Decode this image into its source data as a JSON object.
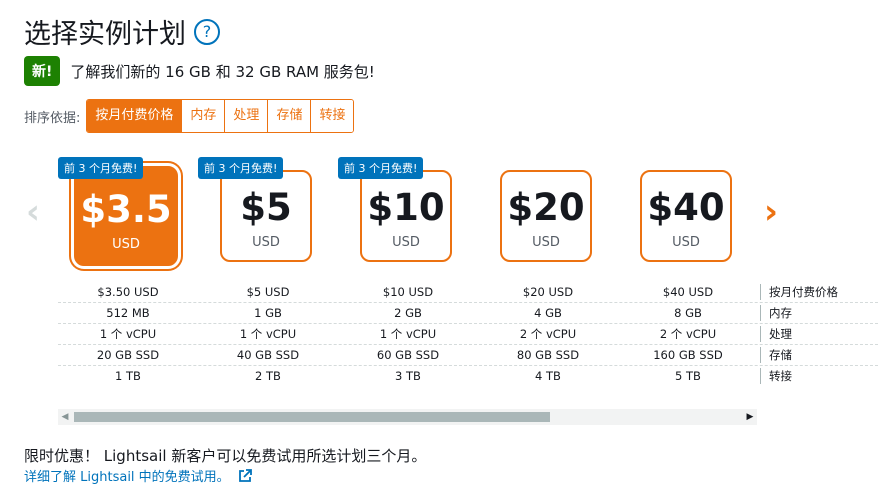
{
  "header": {
    "title": "选择实例计划",
    "help_icon": "?"
  },
  "promo": {
    "badge": "新!",
    "text": "了解我们新的 16 GB 和 32 GB RAM 服务包!"
  },
  "sort": {
    "label": "排序依据:",
    "options": [
      "按月付费价格",
      "内存",
      "处理",
      "存储",
      "转接"
    ],
    "selected": "按月付费价格"
  },
  "accent_color": "#ec7211",
  "link_color": "#0073bb",
  "badge_color": "#1d8102",
  "plans": [
    {
      "price": "$3.5",
      "unit": "USD",
      "free_badge": "前 3 个月免费!",
      "selected": true,
      "monthly": "$3.50 USD",
      "memory": "512 MB",
      "cpu": "1 个 vCPU",
      "storage": "20 GB SSD",
      "transfer": "1 TB"
    },
    {
      "price": "$5",
      "unit": "USD",
      "free_badge": "前 3 个月免费!",
      "selected": false,
      "monthly": "$5 USD",
      "memory": "1 GB",
      "cpu": "1 个 vCPU",
      "storage": "40 GB SSD",
      "transfer": "2 TB"
    },
    {
      "price": "$10",
      "unit": "USD",
      "free_badge": "前 3 个月免费!",
      "selected": false,
      "monthly": "$10 USD",
      "memory": "2 GB",
      "cpu": "1 个 vCPU",
      "storage": "60 GB SSD",
      "transfer": "3 TB"
    },
    {
      "price": "$20",
      "unit": "USD",
      "free_badge": "",
      "selected": false,
      "monthly": "$20 USD",
      "memory": "4 GB",
      "cpu": "2 个 vCPU",
      "storage": "80 GB SSD",
      "transfer": "4 TB"
    },
    {
      "price": "$40",
      "unit": "USD",
      "free_badge": "",
      "selected": false,
      "monthly": "$40 USD",
      "memory": "8 GB",
      "cpu": "2 个 vCPU",
      "storage": "160 GB SSD",
      "transfer": "5 TB"
    }
  ],
  "spec_labels": {
    "monthly": "按月付费价格",
    "memory": "内存",
    "cpu": "处理",
    "storage": "存储",
    "transfer": "转接"
  },
  "footer": {
    "text": "限时优惠！ Lightsail 新客户可以免费试用所选计划三个月。",
    "link": "详细了解 Lightsail 中的免费试用。"
  }
}
